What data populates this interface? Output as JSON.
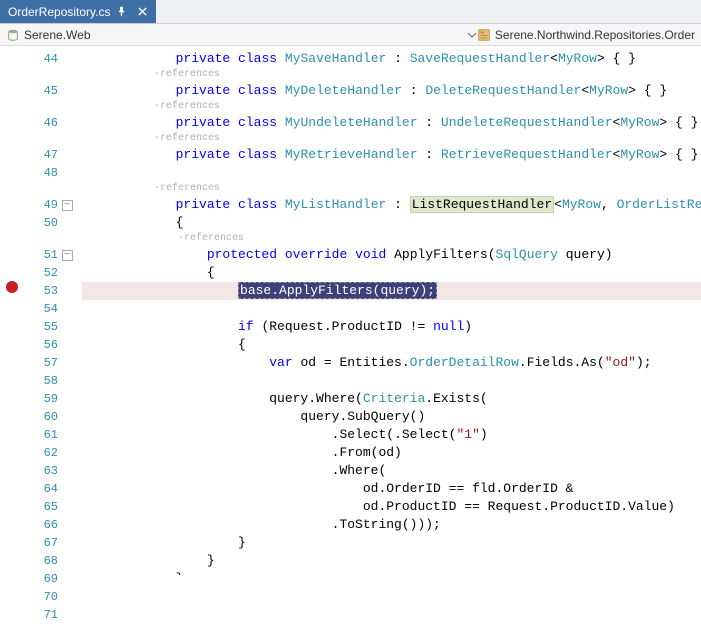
{
  "tab": {
    "title": "OrderRepository.cs"
  },
  "context": {
    "project": "Serene.Web",
    "path": "Serene.Northwind.Repositories.Order"
  },
  "refs_label": "-references",
  "code": {
    "l44": {
      "indent": "            ",
      "kw1": "private",
      "kw2": "class",
      "name": "MySaveHandler",
      "sep": " : ",
      "base": "SaveRequestHandler",
      "lt": "<",
      "gtype": "MyRow",
      "gt": ">",
      "tail": " { }"
    },
    "l45": {
      "indent": "            ",
      "kw1": "private",
      "kw2": "class",
      "name": "MyDeleteHandler",
      "sep": " : ",
      "base": "DeleteRequestHandler",
      "lt": "<",
      "gtype": "MyRow",
      "gt": ">",
      "tail": " { }"
    },
    "l46": {
      "indent": "            ",
      "kw1": "private",
      "kw2": "class",
      "name": "MyUndeleteHandler",
      "sep": " : ",
      "base": "UndeleteRequestHandler",
      "lt": "<",
      "gtype": "MyRow",
      "gt": ">",
      "tail": " { }"
    },
    "l47": {
      "indent": "            ",
      "kw1": "private",
      "kw2": "class",
      "name": "MyRetrieveHandler",
      "sep": " : ",
      "base": "RetrieveRequestHandler",
      "lt": "<",
      "gtype": "MyRow",
      "gt": ">",
      "tail": " { }"
    },
    "l49": {
      "indent": "            ",
      "kw1": "private",
      "kw2": "class",
      "name": "MyListHandler",
      "sep": " : ",
      "base": "ListRequestHandler",
      "lt": "<",
      "gtype1": "MyRow",
      "comma": ", ",
      "gtype2": "OrderListRequest",
      "gt": ">"
    },
    "l50": "            {",
    "l51": {
      "indent": "                ",
      "kw1": "protected",
      "kw2": "override",
      "kw3": "void",
      "name": " ApplyFilters(",
      "ptype": "SqlQuery",
      "pname": " query)"
    },
    "l52": "                {",
    "l53": {
      "indent": "                    ",
      "sel": "base.ApplyFilters(query);"
    },
    "l55": {
      "indent": "                    ",
      "kw1": "if",
      "rest": " (Request.ProductID != ",
      "kw2": "null",
      "close": ")"
    },
    "l56": "                    {",
    "l57": {
      "indent": "                        ",
      "kw1": "var",
      "rest1": " od = Entities.",
      "type1": "OrderDetailRow",
      "rest2": ".Fields.As(",
      "str": "\"od\"",
      "rest3": ");"
    },
    "l59": {
      "indent": "                        ",
      "rest1": "query.Where(",
      "type1": "Criteria",
      "rest2": ".Exists("
    },
    "l60": "                            query.SubQuery()",
    "l61": {
      "indent": "                                .Select(",
      "str": "\"1\"",
      "tail": ")"
    },
    "l62": "                                .From(od)",
    "l63": "                                .Where(",
    "l64": "                                    od.OrderID == fld.OrderID &",
    "l65": "                                    od.ProductID == Request.ProductID.Value)",
    "l66": "                                .ToString()));",
    "l67": "                    }",
    "l68": "                }",
    "l69": "            }",
    "l70": "        }",
    "l71": "    }"
  },
  "lineNumbers": [
    "44",
    "45",
    "46",
    "47",
    "48",
    "49",
    "50",
    "51",
    "52",
    "53",
    "54",
    "55",
    "56",
    "57",
    "58",
    "59",
    "60",
    "61",
    "62",
    "63",
    "64",
    "65",
    "66",
    "67",
    "68",
    "69",
    "70",
    "71"
  ]
}
